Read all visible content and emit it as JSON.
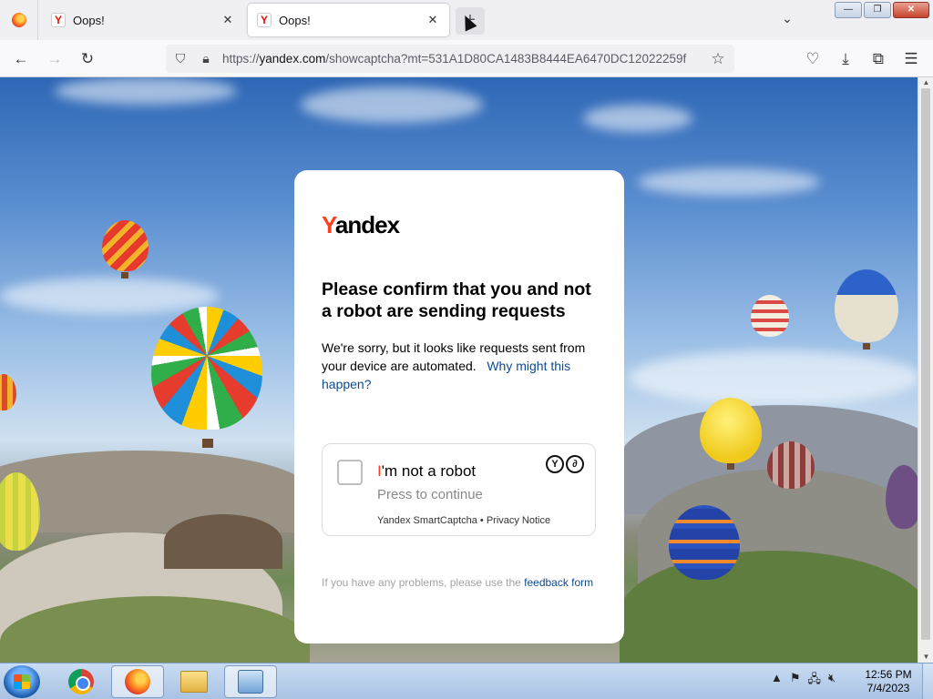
{
  "tabs": [
    {
      "title": "Oops!",
      "favicon": "Y",
      "active": false
    },
    {
      "title": "Oops!",
      "favicon": "Y",
      "active": true
    }
  ],
  "tab_close": "✕",
  "new_tab": "+",
  "window_controls": {
    "minimize": "—",
    "restore": "❐",
    "close": "✕"
  },
  "nav": {
    "back": "←",
    "forward": "→",
    "reload": "↻",
    "url_scheme": "https://",
    "url_host": "yandex.com",
    "url_path": "/showcaptcha?mt=531A1D80CA1483B8444EA6470DC12022259f",
    "star": "☆",
    "pocket": "♡",
    "download": "⤓",
    "extensions": "⧉",
    "menu": "☰"
  },
  "card": {
    "brand_first": "Y",
    "brand_rest": "andex",
    "heading": "Please confirm that you and not a robot are sending requests",
    "desc_text": "We're sorry, but it looks like requests sent from your device are automated.",
    "desc_link": "Why might this happen?",
    "robot_label_first": "I",
    "robot_label_rest": "'m not a robot",
    "robot_sub": "Press to continue",
    "robot_foot": "Yandex SmartCaptcha • Privacy Notice",
    "problems_text": "If you have any problems, please use the ",
    "problems_link": "feedback form"
  },
  "taskbar": {
    "time": "12:56 PM",
    "date": "7/4/2023"
  },
  "colors": {
    "yandex_red": "#fc3f1d",
    "link": "#0e4b92"
  }
}
